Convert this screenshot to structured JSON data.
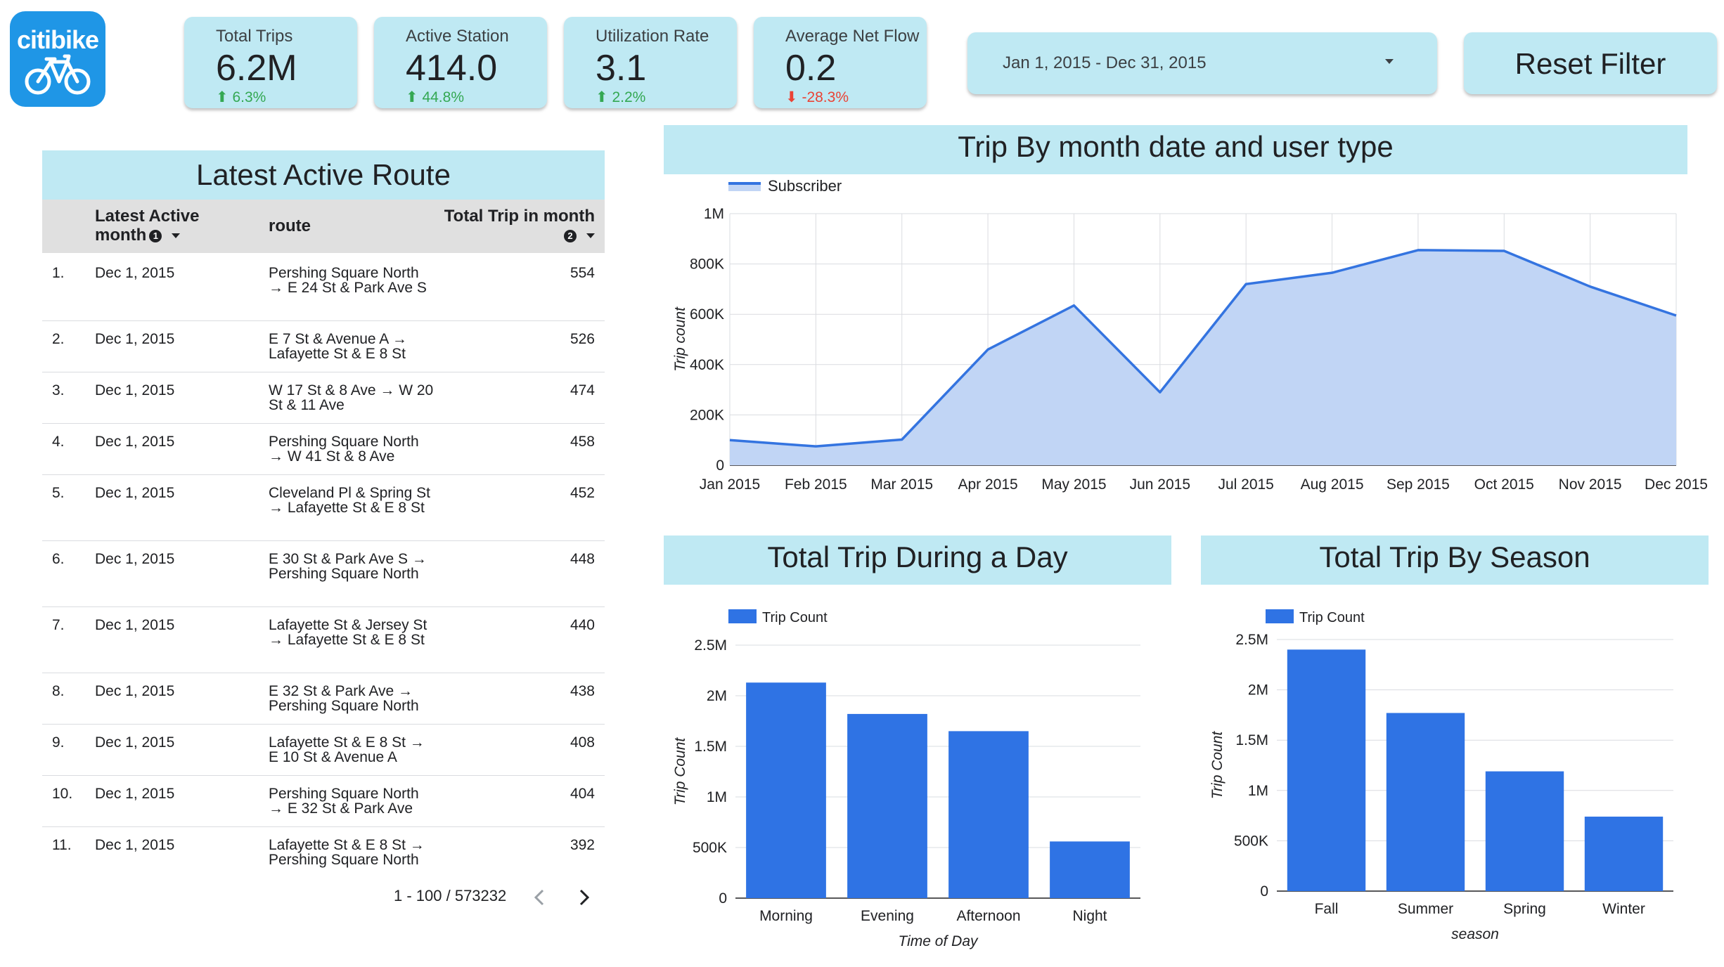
{
  "logo": {
    "text": "citibike"
  },
  "kpis": [
    {
      "label": "Total Trips",
      "value": "6.2M",
      "delta": "6.3%",
      "direction": "up",
      "arrow": "⬆"
    },
    {
      "label": "Active Station",
      "value": "414.0",
      "delta": "44.8%",
      "direction": "up",
      "arrow": "⬆"
    },
    {
      "label": "Utilization Rate",
      "value": "3.1",
      "delta": "2.2%",
      "direction": "up",
      "arrow": "⬆"
    },
    {
      "label": "Average Net Flow",
      "value": "0.2",
      "delta": "-28.3%",
      "direction": "down",
      "arrow": "⬇"
    }
  ],
  "date_filter": {
    "value": "Jan 1, 2015 - Dec 31, 2015"
  },
  "reset_label": "Reset Filter",
  "table": {
    "title": "Latest Active Route",
    "headers": {
      "month_line1": "Latest Active",
      "month_line2": "month",
      "month_sort": "1",
      "route": "route",
      "total": "Total Trip in month",
      "total_sort": "2"
    },
    "rows": [
      {
        "idx": "1.",
        "month": "Dec 1, 2015",
        "route": "Pershing Square North → E 24 St & Park Ave S",
        "total": "554"
      },
      {
        "idx": "2.",
        "month": "Dec 1, 2015",
        "route": "E 7 St & Avenue A → Lafayette St & E 8 St",
        "total": "526"
      },
      {
        "idx": "3.",
        "month": "Dec 1, 2015",
        "route": "W 17 St & 8 Ave → W 20 St & 11 Ave",
        "total": "474"
      },
      {
        "idx": "4.",
        "month": "Dec 1, 2015",
        "route": "Pershing Square North → W 41 St & 8 Ave",
        "total": "458"
      },
      {
        "idx": "5.",
        "month": "Dec 1, 2015",
        "route": "Cleveland Pl & Spring St → Lafayette St & E 8 St",
        "total": "452"
      },
      {
        "idx": "6.",
        "month": "Dec 1, 2015",
        "route": "E 30 St & Park Ave S → Pershing Square North",
        "total": "448"
      },
      {
        "idx": "7.",
        "month": "Dec 1, 2015",
        "route": "Lafayette St & Jersey St → Lafayette St & E 8 St",
        "total": "440"
      },
      {
        "idx": "8.",
        "month": "Dec 1, 2015",
        "route": "E 32 St & Park Ave → Pershing Square North",
        "total": "438"
      },
      {
        "idx": "9.",
        "month": "Dec 1, 2015",
        "route": "Lafayette St & E 8 St → E 10 St & Avenue A",
        "total": "408"
      },
      {
        "idx": "10.",
        "month": "Dec 1, 2015",
        "route": "Pershing Square North → E 32 St & Park Ave",
        "total": "404"
      },
      {
        "idx": "11.",
        "month": "Dec 1, 2015",
        "route": "Lafayette St & E 8 St → Pershing Square North",
        "total": "392"
      }
    ],
    "pagination": "1 - 100 / 573232"
  },
  "chart_data": [
    {
      "type": "area",
      "title": "Trip By month date and user type",
      "categories": [
        "Jan 2015",
        "Feb 2015",
        "Mar 2015",
        "Apr 2015",
        "May 2015",
        "Jun 2015",
        "Jul 2015",
        "Aug 2015",
        "Sep 2015",
        "Oct 2015",
        "Nov 2015",
        "Dec 2015"
      ],
      "series": [
        {
          "name": "Subscriber",
          "values": [
            100000,
            75000,
            102000,
            460000,
            635000,
            290000,
            720000,
            765000,
            855000,
            852000,
            710000,
            595000
          ]
        }
      ],
      "xlabel": "",
      "ylabel": "Trip count",
      "ylim": [
        0,
        1000000
      ],
      "yticks": [
        "0",
        "200K",
        "400K",
        "600K",
        "800K",
        "1M"
      ],
      "grid": true,
      "legend": "top-left",
      "color": "#3474e0",
      "fill": "#c1d5f5"
    },
    {
      "type": "bar",
      "title": "Total Trip During a Day",
      "categories": [
        "Morning",
        "Evening",
        "Afternoon",
        "Night"
      ],
      "series": [
        {
          "name": "Trip Count",
          "values": [
            2130000,
            1820000,
            1650000,
            560000
          ]
        }
      ],
      "xlabel": "Time of Day",
      "ylabel": "Trip Count",
      "ylim": [
        0,
        2500000
      ],
      "yticks": [
        "0",
        "500K",
        "1M",
        "1.5M",
        "2M",
        "2.5M"
      ],
      "grid": true,
      "legend": "top-left",
      "color": "#2f73e4"
    },
    {
      "type": "bar",
      "title": "Total Trip By Season",
      "categories": [
        "Fall",
        "Summer",
        "Spring",
        "Winter"
      ],
      "series": [
        {
          "name": "Trip Count",
          "values": [
            2400000,
            1770000,
            1190000,
            740000
          ]
        }
      ],
      "xlabel": "season",
      "ylabel": "Trip Count",
      "ylim": [
        0,
        2500000
      ],
      "yticks": [
        "0",
        "500K",
        "1M",
        "1.5M",
        "2M",
        "2.5M"
      ],
      "grid": true,
      "legend": "top-left",
      "color": "#2f73e4"
    }
  ]
}
